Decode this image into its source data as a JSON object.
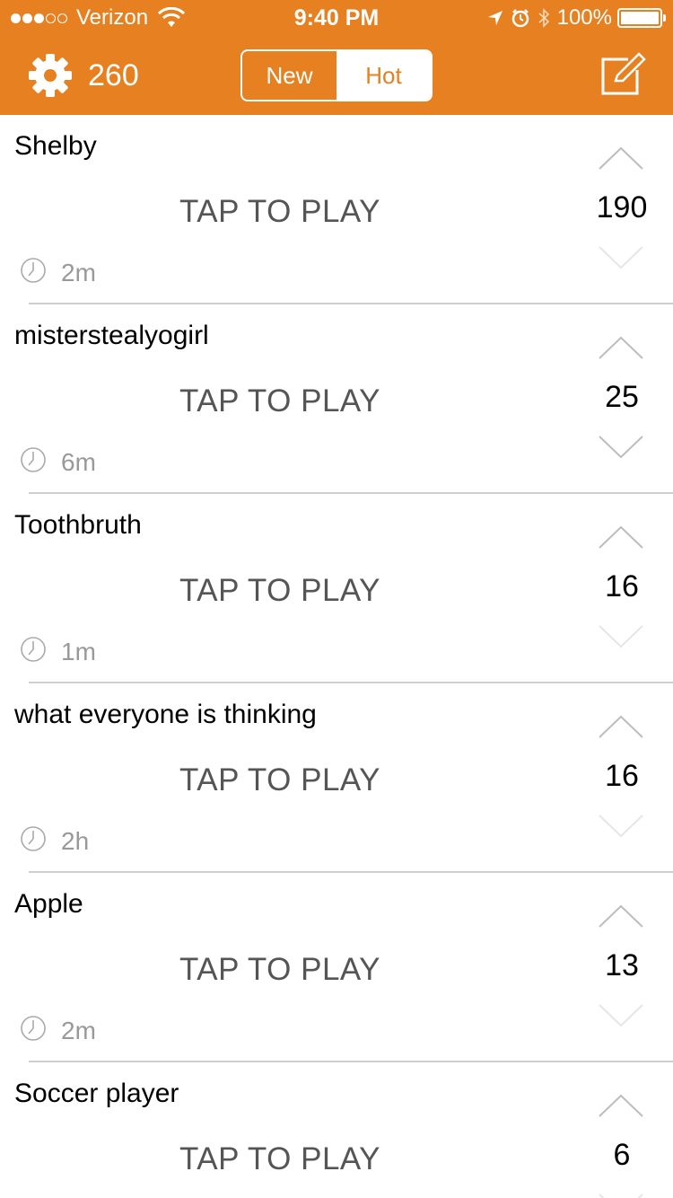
{
  "status_bar": {
    "carrier": "Verizon",
    "time": "9:40 PM",
    "battery": "100%",
    "signal_icon": "signal-dots-icon",
    "wifi_icon": "wifi-icon"
  },
  "nav": {
    "score": "260",
    "tabs": [
      {
        "label": "New",
        "selected": false
      },
      {
        "label": "Hot",
        "selected": true
      }
    ],
    "settings_icon": "gear-icon",
    "compose_icon": "compose-icon"
  },
  "accent_color": "#e68020",
  "feed": [
    {
      "title": "Shelby",
      "play_label": "TAP TO PLAY",
      "time": "2m",
      "votes": "190"
    },
    {
      "title": "misterstealyogirl",
      "play_label": "TAP TO PLAY",
      "time": "6m",
      "votes": "25"
    },
    {
      "title": "Toothbruth",
      "play_label": "TAP TO PLAY",
      "time": "1m",
      "votes": "16"
    },
    {
      "title": "what everyone is thinking",
      "play_label": "TAP TO PLAY",
      "time": "2h",
      "votes": "16"
    },
    {
      "title": "Apple",
      "play_label": "TAP TO PLAY",
      "time": "2m",
      "votes": "13"
    },
    {
      "title": "Soccer player",
      "play_label": "TAP TO PLAY",
      "time": "",
      "votes": "6"
    }
  ]
}
